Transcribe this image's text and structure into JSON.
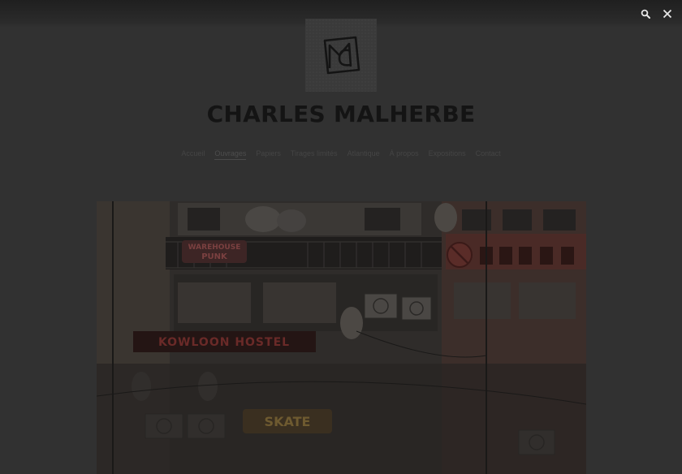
{
  "header": {
    "search_icon": "search-icon",
    "close_icon": "close-icon"
  },
  "site": {
    "logo_letters": "MC",
    "title": "CHARLES MALHERBE"
  },
  "nav": {
    "items": [
      {
        "label": "Accueil"
      },
      {
        "label": "Ouvrages"
      },
      {
        "label": "Papiers"
      },
      {
        "label": "Tirages limités"
      },
      {
        "label": "Atlantique"
      },
      {
        "label": "À propos"
      },
      {
        "label": "Expositions"
      },
      {
        "label": "Contact"
      }
    ],
    "active_index": 1
  },
  "photo": {
    "signs": [
      "WAREHOUSE PUNK",
      "KOWLOON HOSTEL",
      "SKATE"
    ]
  },
  "colors": {
    "background": "#313131",
    "topbar": "#1f1f1f",
    "title": "#141414",
    "icon": "#e8e8e8"
  }
}
